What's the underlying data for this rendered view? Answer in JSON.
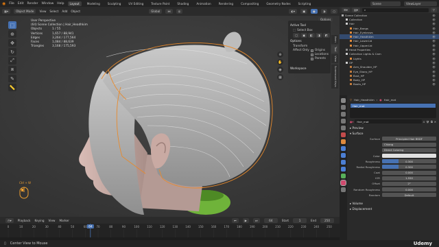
{
  "topbar": {
    "menus": [
      "File",
      "Edit",
      "Render",
      "Window",
      "Help"
    ],
    "workspaces": [
      "Layout",
      "Modeling",
      "Sculpting",
      "UV Editing",
      "Texture Paint",
      "Shading",
      "Animation",
      "Rendering",
      "Compositing",
      "Geometry Nodes",
      "Scripting"
    ],
    "active_workspace": "Layout",
    "scene": "Scene",
    "view_layer": "ViewLayer"
  },
  "viewport_header": {
    "mode": "Object Mode",
    "menus": [
      "View",
      "Select",
      "Add",
      "Object"
    ],
    "orientation": "Global",
    "options": "Options"
  },
  "stats": {
    "view": "User Perspective",
    "collection": "(64) Scene Collection | Hair_Headhkim",
    "rows": [
      {
        "k": "Objects",
        "v": "1 / 55"
      },
      {
        "k": "Vertices",
        "v": "1,657 / 88,941"
      },
      {
        "k": "Edges",
        "v": "3,264 / 177,564"
      },
      {
        "k": "Faces",
        "v": "1,084 / 88,639"
      },
      {
        "k": "Triangles",
        "v": "3,168 / 175,593"
      }
    ]
  },
  "npanel": {
    "active_tool": "Active Tool",
    "tool": "Select Box",
    "options": "Options",
    "transform": "Transform",
    "affect_only": "Affect Only",
    "affect_items": [
      "Origins",
      "Locations",
      "Parents"
    ],
    "workspace": "Workspace"
  },
  "sidetabs": [
    "Item",
    "Tool",
    "View",
    "Screencast Keys"
  ],
  "mouse_label": "Ctrl + W",
  "timeline": {
    "menus": [
      "Playback",
      "Keying",
      "View",
      "Marker"
    ],
    "current": "64",
    "start_label": "Start",
    "start": "1",
    "end_label": "End",
    "end": "250"
  },
  "ruler": {
    "ticks": [
      "0",
      "10",
      "20",
      "30",
      "40",
      "50",
      "60",
      "70",
      "80",
      "90",
      "100",
      "110",
      "120",
      "130",
      "140",
      "150",
      "160",
      "170",
      "180",
      "190",
      "200",
      "210",
      "220",
      "230",
      "240",
      "250"
    ],
    "current": "64"
  },
  "status": {
    "hint": "Center View to Mouse",
    "brand": "Udemy"
  },
  "outliner": {
    "rows": [
      {
        "t": "Scene Collection",
        "d": 0,
        "c": "#aaaaaa",
        "sel": false
      },
      {
        "t": "Collection",
        "d": 1,
        "c": "#d0d0d0",
        "sel": false
      },
      {
        "t": "Hair",
        "d": 1,
        "c": "#d0d0d0",
        "sel": false
      },
      {
        "t": "Hair_Bangs",
        "d": 2,
        "c": "#e08a3c",
        "sel": false
      },
      {
        "t": "Hair_Eyebrows",
        "d": 2,
        "c": "#e08a3c",
        "sel": false
      },
      {
        "t": "Hair_Headhkim",
        "d": 2,
        "c": "#e08a3c",
        "sel": true
      },
      {
        "t": "Hair_LowerLid",
        "d": 2,
        "c": "#e08a3c",
        "sel": false
      },
      {
        "t": "Hair_UpperLid",
        "d": 2,
        "c": "#e08a3c",
        "sel": false
      },
      {
        "t": "Head Properties",
        "d": 1,
        "c": "#888888",
        "sel": false
      },
      {
        "t": "Collection Lights & Cam",
        "d": 1,
        "c": "#d0d0d0",
        "sel": false
      },
      {
        "t": "Lights",
        "d": 2,
        "c": "#e08a3c",
        "sel": false
      },
      {
        "t": "OP",
        "d": 1,
        "c": "#d0d0d0",
        "sel": false
      },
      {
        "t": "Arm_Shoulder_HP",
        "d": 2,
        "c": "#c07a3c",
        "sel": false
      },
      {
        "t": "Eye_Sharp_HP",
        "d": 2,
        "c": "#c07a3c",
        "sel": false
      },
      {
        "t": "Bust_HP",
        "d": 2,
        "c": "#c07a3c",
        "sel": false
      },
      {
        "t": "Body_HP",
        "d": 2,
        "c": "#c07a3c",
        "sel": false
      },
      {
        "t": "Boots_HP",
        "d": 2,
        "c": "#c07a3c",
        "sel": false
      }
    ]
  },
  "props": {
    "breadcrumb": "Hair_Headhkim",
    "breadcrumb2": "Hair_mat",
    "slot": "Hair_mat",
    "material": "Hair_mat",
    "preview": "Preview",
    "surface_section": "Surface",
    "surface_label": "Surface",
    "surface_value": "Principled Hair BSDF",
    "param_a": "Chiang",
    "param_b": "Direct Coloring",
    "rows": [
      {
        "label": "Color",
        "value": "",
        "fill": 0,
        "swatch": true
      },
      {
        "label": "Roughness",
        "value": "0.300",
        "fill": 0.3,
        "swatch": false
      },
      {
        "label": "Radial Roughness",
        "value": "0.300",
        "fill": 0.3,
        "swatch": false
      },
      {
        "label": "Coat",
        "value": "0.000",
        "fill": 0,
        "swatch": false
      },
      {
        "label": "IOR",
        "value": "1.550",
        "fill": 0,
        "swatch": false
      },
      {
        "label": "Offset",
        "value": "2°",
        "fill": 0,
        "swatch": false
      },
      {
        "label": "Random Roughness",
        "value": "0.000",
        "fill": 0,
        "swatch": false
      },
      {
        "label": "Random",
        "value": "Default",
        "fill": 0,
        "swatch": false
      }
    ],
    "volume": "Volume",
    "displacement": "Displacement"
  },
  "colors": {
    "accent": "#4772b3",
    "selection": "#e88a2c",
    "ground": "#7fbf3a"
  }
}
